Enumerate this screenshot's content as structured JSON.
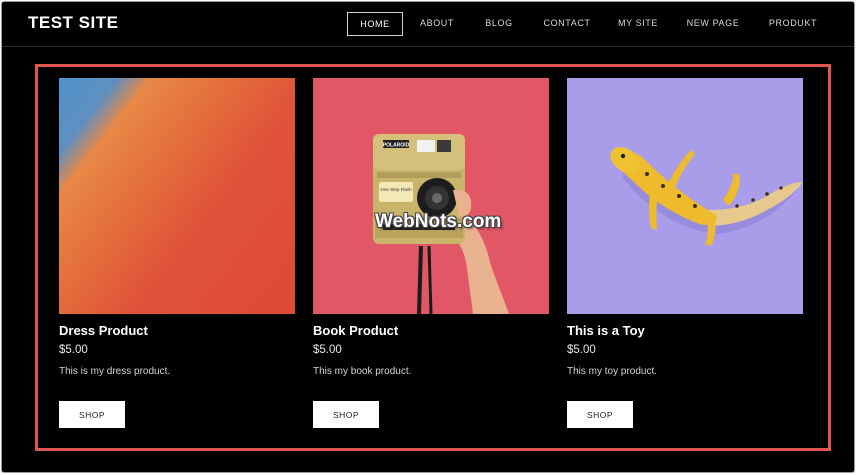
{
  "site": {
    "title": "TEST SITE"
  },
  "nav": {
    "items": [
      {
        "label": "HOME",
        "active": true
      },
      {
        "label": "ABOUT",
        "active": false
      },
      {
        "label": "BLOG",
        "active": false
      },
      {
        "label": "CONTACT",
        "active": false
      },
      {
        "label": "MY SITE",
        "active": false
      },
      {
        "label": "NEW PAGE",
        "active": false
      },
      {
        "label": "PRODUKT",
        "active": false
      }
    ]
  },
  "products": [
    {
      "name": "Dress Product",
      "price": "$5.00",
      "description": "This is my dress product.",
      "button_label": "SHOP",
      "image_color": "#e0533a"
    },
    {
      "name": "Book Product",
      "price": "$5.00",
      "description": "This my book product.",
      "button_label": "SHOP",
      "image_color": "#e25766"
    },
    {
      "name": "This is a Toy",
      "price": "$5.00",
      "description": "This my toy product.",
      "button_label": "SHOP",
      "image_color": "#a99ce9"
    }
  ],
  "camera_text": {
    "brand": "POLAROID",
    "button_label": "One Step Flash"
  },
  "watermark": "WebNots.com",
  "colors": {
    "background": "#000000",
    "highlight": "#e0574f",
    "text": "#ffffff"
  }
}
